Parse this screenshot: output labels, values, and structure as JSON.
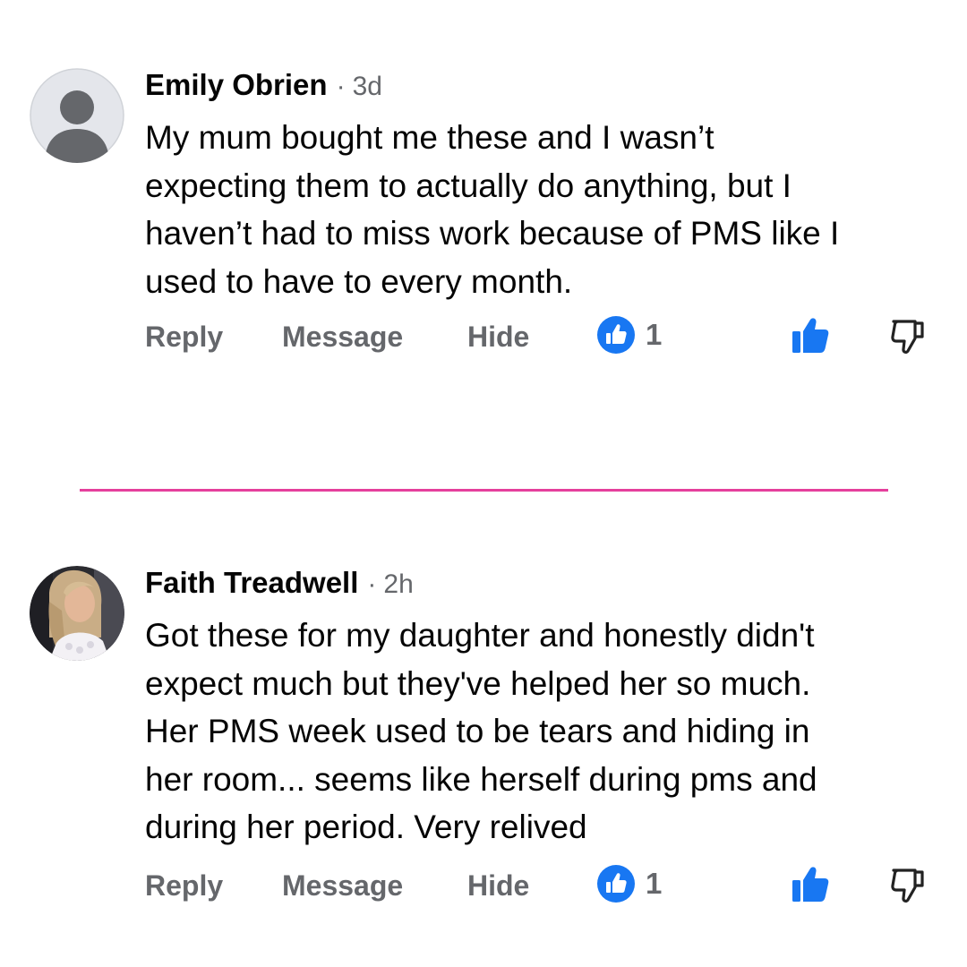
{
  "colors": {
    "divider": "#e5409c",
    "like_blue": "#1877f2",
    "muted_text": "#65676b"
  },
  "comments": [
    {
      "author": "Emily Obrien",
      "separator": "·",
      "time": "3d",
      "avatar": "default-person-avatar",
      "text_lines": [
        "My mum bought me these and I wasn’t",
        "expecting them to actually do anything, but I",
        "haven’t had to miss work because of PMS like I",
        "used to have to every month."
      ],
      "actions": {
        "reply": "Reply",
        "message": "Message",
        "hide": "Hide"
      },
      "reaction_icon": "like-reaction-icon",
      "reaction_count": "1"
    },
    {
      "author": "Faith Treadwell",
      "separator": "·",
      "time": "2h",
      "avatar": "profile-photo",
      "text_lines": [
        "Got these for my daughter and honestly didn't",
        "expect much but they've helped her so much.",
        "Her PMS week used to be tears and hiding in",
        "her room... seems like herself during pms and",
        "during her period. Very relived"
      ],
      "actions": {
        "reply": "Reply",
        "message": "Message",
        "hide": "Hide"
      },
      "reaction_icon": "like-reaction-icon",
      "reaction_count": "1"
    }
  ]
}
